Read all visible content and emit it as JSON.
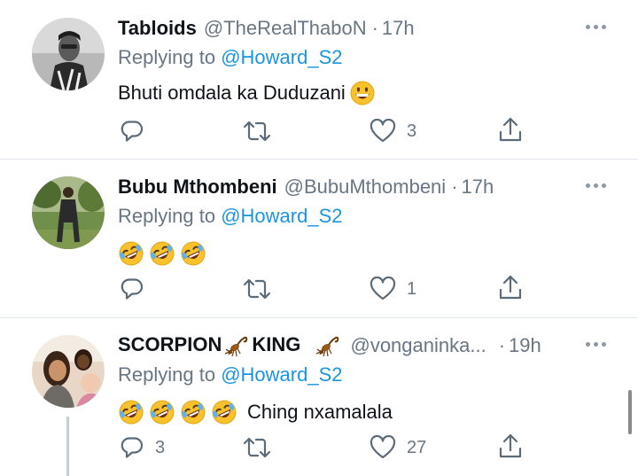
{
  "tweets": [
    {
      "name": "Tabloids",
      "handle": "@TheRealThaboN",
      "dot": "·",
      "time": "17h",
      "replying_prefix": "Replying to",
      "replying_to": "@Howard_S2",
      "text": "Bhuti omdala ka Duduzani",
      "text_emoji": [
        "grinning-face"
      ],
      "reply_count": "",
      "retweet_count": "",
      "like_count": "3"
    },
    {
      "name": "Bubu Mthombeni",
      "handle": "@BubuMthombeni",
      "dot": "·",
      "time": "17h",
      "replying_prefix": "Replying to",
      "replying_to": "@Howard_S2",
      "text": "",
      "text_emoji": [
        "rolling-on-floor-laughing",
        "rolling-on-floor-laughing",
        "rolling-on-floor-laughing"
      ],
      "reply_count": "",
      "retweet_count": "",
      "like_count": "1"
    },
    {
      "name_part1": "SCORPION",
      "name_part2": "KING",
      "name_emoji": [
        "scorpion",
        "scorpion"
      ],
      "handle": "@vonganinka...",
      "dot": "·",
      "time": "19h",
      "replying_prefix": "Replying to",
      "replying_to": "@Howard_S2",
      "text": "Ching nxamalala",
      "text_emoji": [
        "rolling-on-floor-laughing",
        "rolling-on-floor-laughing",
        "rolling-on-floor-laughing",
        "rolling-on-floor-laughing"
      ],
      "reply_count": "3",
      "retweet_count": "",
      "like_count": "27"
    }
  ],
  "icons": {
    "reply": "reply-icon",
    "retweet": "retweet-icon",
    "like": "heart-icon",
    "share": "share-icon",
    "more": "more-icon"
  },
  "colors": {
    "text": "#0f1419",
    "secondary": "#687684",
    "mention": "#1b95e0",
    "divider": "#e1e8ed",
    "icon": "#5b6b78"
  }
}
